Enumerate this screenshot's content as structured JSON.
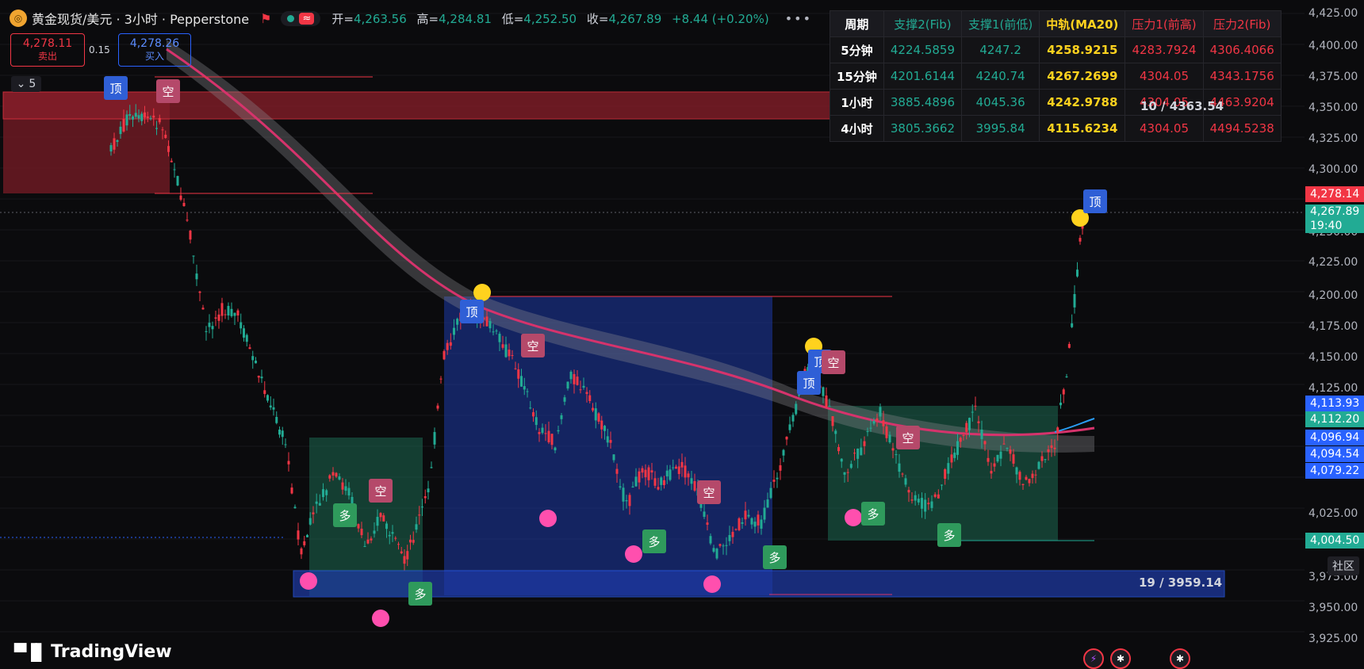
{
  "header": {
    "symbol": "黄金现货/美元 · 3小时 · Pepperstone",
    "wave_icon": "≈",
    "open_label": "开=",
    "open_value": "4,263.56",
    "high_label": "高=",
    "high_value": "4,284.81",
    "low_label": "低=",
    "low_value": "4,252.50",
    "close_label": "收=",
    "close_value": "4,267.89",
    "change": "+8.44 (+0.20%)"
  },
  "trade": {
    "sell_price": "4,278.11",
    "sell_label": "卖出",
    "spread": "0.15",
    "buy_price": "4,278.26",
    "buy_label": "买入"
  },
  "interval_value": "5",
  "table": {
    "headers": [
      "周期",
      "支撑2(Fib)",
      "支撑1(前低)",
      "中轨(MA20)",
      "压力1(前高)",
      "压力2(Fib)"
    ],
    "rows": [
      [
        "5分钟",
        "4224.5859",
        "4247.2",
        "4258.9215",
        "4283.7924",
        "4306.4066"
      ],
      [
        "15分钟",
        "4201.6144",
        "4240.74",
        "4267.2699",
        "4304.05",
        "4343.1756"
      ],
      [
        "1小时",
        "3885.4896",
        "4045.36",
        "4242.9788",
        "4304.05",
        "4463.9204"
      ],
      [
        "4小时",
        "3805.3662",
        "3995.84",
        "4115.6234",
        "4304.05",
        "4494.5238"
      ]
    ]
  },
  "price_axis": {
    "labels": [
      "4,425.00",
      "4,400.00",
      "4,375.00",
      "4,350.00",
      "4,325.00",
      "4,300.00",
      "4,250.00",
      "4,225.00",
      "4,200.00",
      "4,175.00",
      "4,150.00",
      "4,125.00",
      "4,025.00",
      "3,950.00",
      "3,925.00"
    ],
    "tag_sell": "4,278.14",
    "tag_current": "4,267.89",
    "tag_timer": "19:40",
    "tag_4113": "4,113.93",
    "tag_4112": "4,112.20",
    "tag_4096": "4,096.94",
    "tag_4094": "4,094.54",
    "tag_4079": "4,079.22",
    "tag_4004": "4,004.50",
    "tag_3975": "3,975.00"
  },
  "boxes": {
    "upper_label": "10 / 4363.54",
    "lower_label": "19 / 3959.14"
  },
  "markers": {
    "top": "顶",
    "short": "空",
    "long": "多"
  },
  "community": "社区",
  "brand": "TradingView",
  "colors": {
    "bull": "#22ab94",
    "bear": "#f23645",
    "blue": "#2962ff",
    "yellow": "#ffd21e",
    "pink": "#ff4fae"
  }
}
